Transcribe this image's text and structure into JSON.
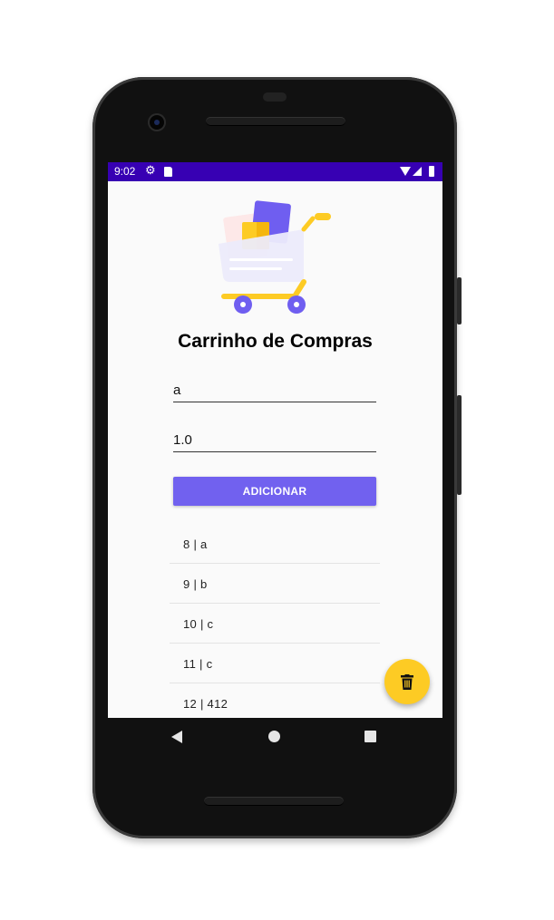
{
  "status_bar": {
    "time": "9:02",
    "icons": [
      "gear-icon",
      "sd-card-icon",
      "wifi-icon",
      "signal-icon",
      "battery-icon"
    ]
  },
  "app": {
    "logo": "shopping-cart-illustration",
    "title": "Carrinho de Compras",
    "name_field": {
      "value": "a"
    },
    "price_field": {
      "value": "1.0"
    },
    "add_button_label": "ADICIONAR",
    "items": [
      {
        "label": "8 | a"
      },
      {
        "label": "9 | b"
      },
      {
        "label": "10 | c"
      },
      {
        "label": "11 | c"
      },
      {
        "label": "12 | 412"
      }
    ],
    "fab_icon": "trash-icon"
  },
  "nav_bar": {
    "icons": [
      "back-icon",
      "home-icon",
      "recents-icon"
    ]
  },
  "colors": {
    "status_bar": "#3700b3",
    "accent_button": "#7161ef",
    "fab": "#fdcb24",
    "background": "#fafafa"
  }
}
